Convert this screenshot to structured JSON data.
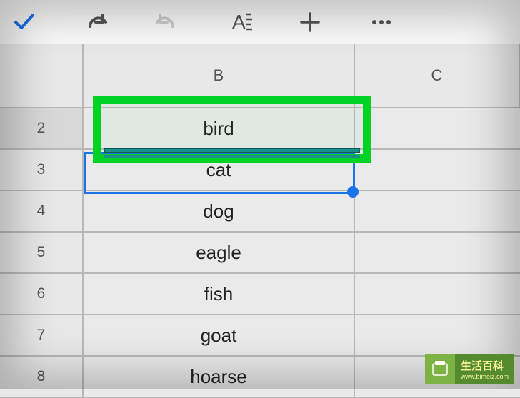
{
  "toolbar": {
    "confirm": "✓",
    "undo": "↶",
    "redo": "↷",
    "font": "A",
    "add": "+",
    "more": "•••"
  },
  "columns": {
    "a": "",
    "b": "B",
    "c": "C"
  },
  "rows": [
    {
      "num": "2",
      "value": "bird",
      "selected": true
    },
    {
      "num": "3",
      "value": "cat",
      "selected": false
    },
    {
      "num": "4",
      "value": "dog",
      "selected": false
    },
    {
      "num": "5",
      "value": "eagle",
      "selected": false
    },
    {
      "num": "6",
      "value": "fish",
      "selected": false
    },
    {
      "num": "7",
      "value": "goat",
      "selected": false
    },
    {
      "num": "8",
      "value": "hoarse",
      "selected": false
    }
  ],
  "chart_data": {
    "type": "table",
    "columns": [
      "B",
      "C"
    ],
    "rows": {
      "2": "bird",
      "3": "cat",
      "4": "dog",
      "5": "eagle",
      "6": "fish",
      "7": "goat",
      "8": "hoarse"
    }
  },
  "watermark": {
    "title": "生活百科",
    "url": "www.bimeiz.com"
  }
}
